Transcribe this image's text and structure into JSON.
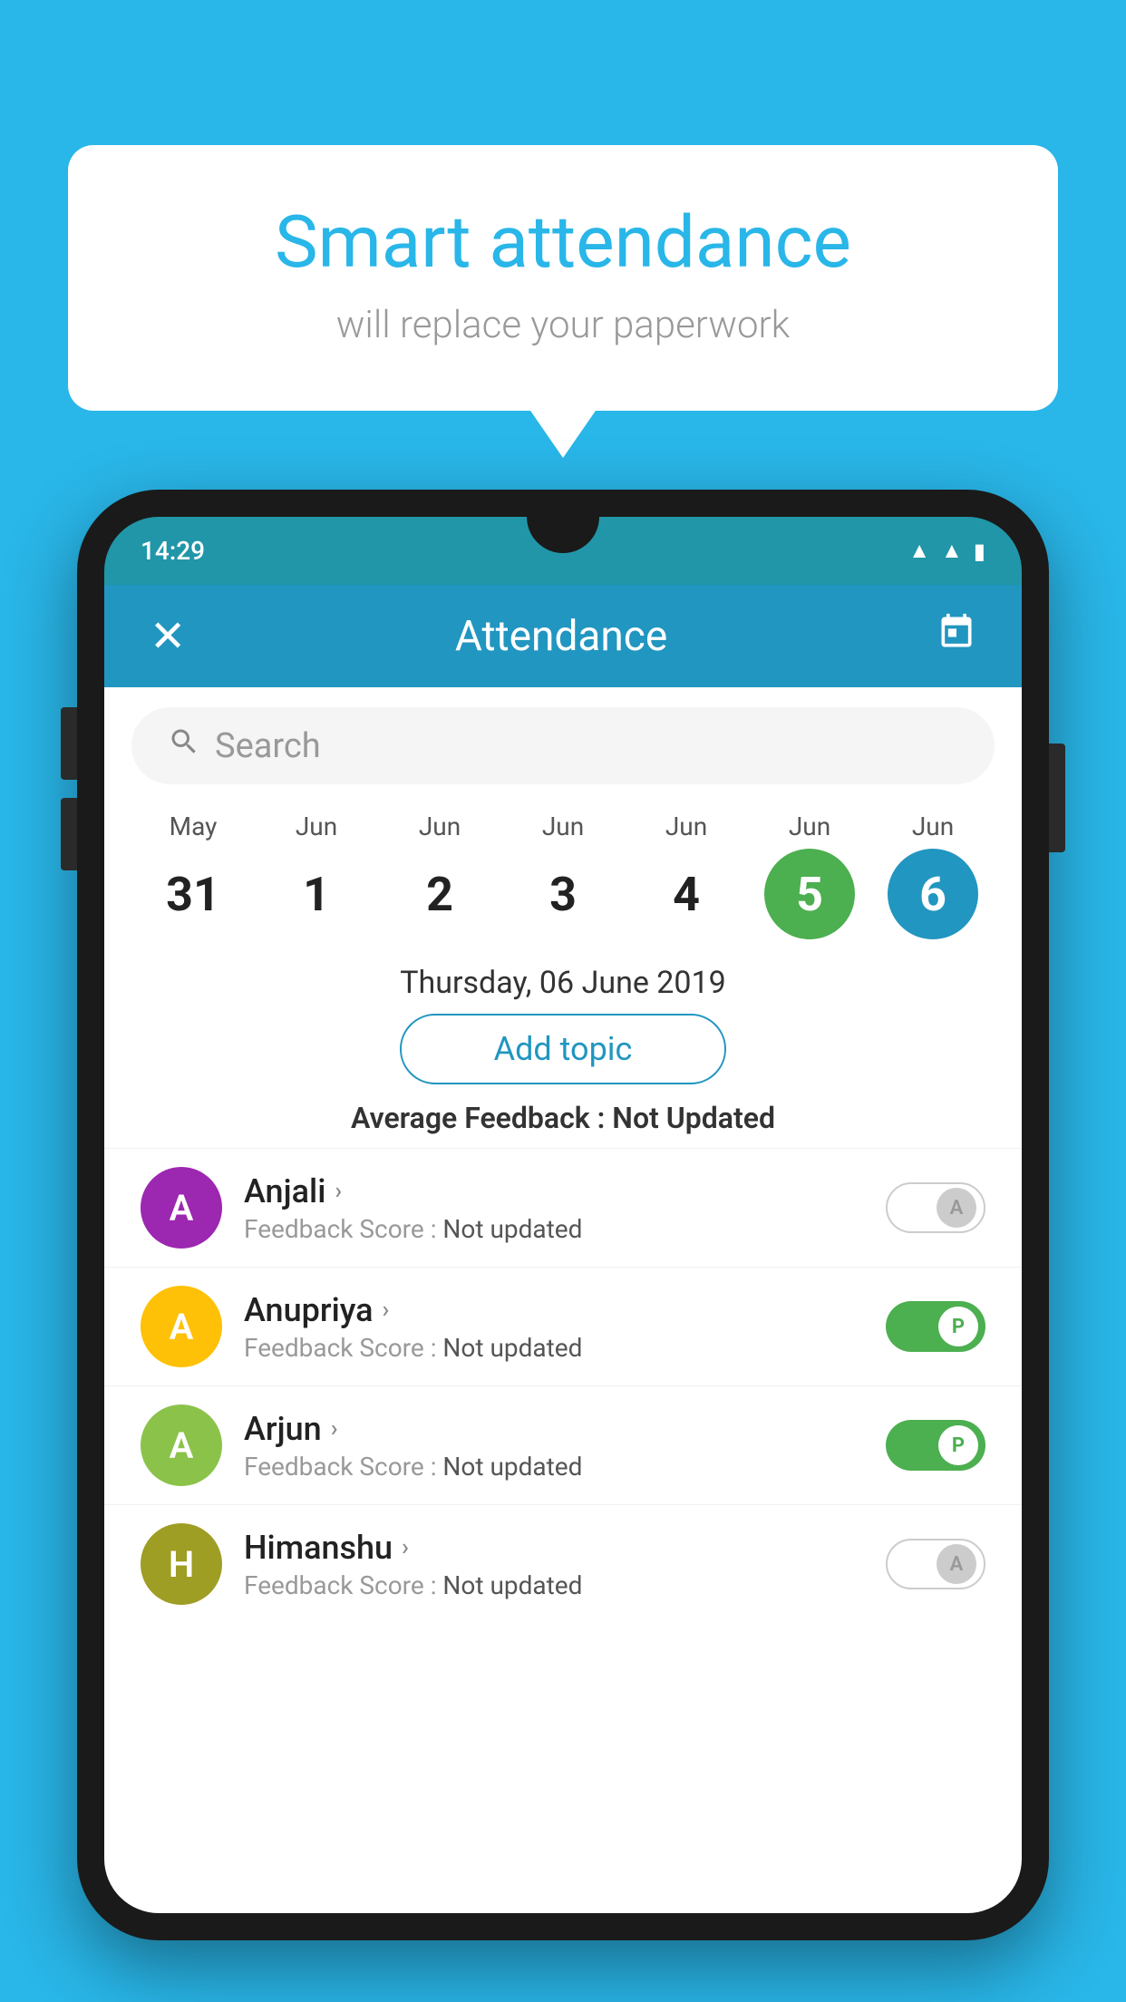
{
  "background_color": "#29B6E8",
  "bubble": {
    "title": "Smart attendance",
    "subtitle": "will replace your paperwork"
  },
  "phone": {
    "status_bar": {
      "time": "14:29"
    },
    "header": {
      "close_icon": "✕",
      "title": "Attendance",
      "calendar_icon": "📅"
    },
    "search": {
      "placeholder": "Search"
    },
    "calendar": {
      "days": [
        {
          "month": "May",
          "num": "31",
          "state": "normal"
        },
        {
          "month": "Jun",
          "num": "1",
          "state": "normal"
        },
        {
          "month": "Jun",
          "num": "2",
          "state": "normal"
        },
        {
          "month": "Jun",
          "num": "3",
          "state": "normal"
        },
        {
          "month": "Jun",
          "num": "4",
          "state": "normal"
        },
        {
          "month": "Jun",
          "num": "5",
          "state": "today"
        },
        {
          "month": "Jun",
          "num": "6",
          "state": "selected"
        }
      ]
    },
    "selected_date": "Thursday, 06 June 2019",
    "add_topic_label": "Add topic",
    "average_feedback_label": "Average Feedback :",
    "average_feedback_value": "Not Updated",
    "students": [
      {
        "name": "Anjali",
        "avatar_letter": "A",
        "avatar_color": "purple",
        "feedback_label": "Feedback Score :",
        "feedback_value": "Not updated",
        "toggle": "off",
        "toggle_letter": "A"
      },
      {
        "name": "Anupriya",
        "avatar_letter": "A",
        "avatar_color": "yellow",
        "feedback_label": "Feedback Score :",
        "feedback_value": "Not updated",
        "toggle": "on",
        "toggle_letter": "P"
      },
      {
        "name": "Arjun",
        "avatar_letter": "A",
        "avatar_color": "green",
        "feedback_label": "Feedback Score :",
        "feedback_value": "Not updated",
        "toggle": "on",
        "toggle_letter": "P"
      },
      {
        "name": "Himanshu",
        "avatar_letter": "H",
        "avatar_color": "olive",
        "feedback_label": "Feedback Score :",
        "feedback_value": "Not updated",
        "toggle": "off",
        "toggle_letter": "A"
      }
    ]
  }
}
